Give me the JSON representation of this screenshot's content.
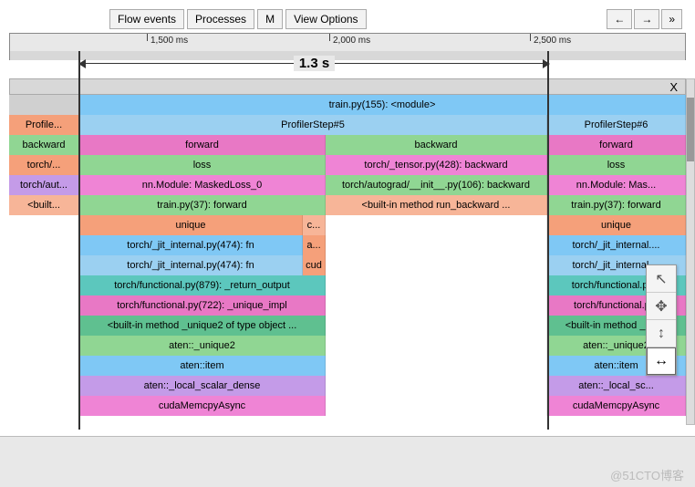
{
  "toolbar": {
    "flow_events": "Flow events",
    "processes": "Processes",
    "m": "M",
    "view_options": "View Options",
    "nav_prev": "←",
    "nav_next": "→",
    "nav_expand": "»"
  },
  "ruler": {
    "t1": "1,500 ms",
    "t2": "2,000 ms",
    "t3": "2,500 ms"
  },
  "range": {
    "label": "1.3 s"
  },
  "close_x": "X",
  "rows": {
    "r1": {
      "a": "train.py(155): <module>"
    },
    "r2": {
      "left": "Profile...",
      "mid": "ProfilerStep#5",
      "right": "ProfilerStep#6"
    },
    "r3": {
      "left": "backward",
      "mid1": "forward",
      "mid2": "backward",
      "right": "forward"
    },
    "r4": {
      "left": "torch/...",
      "mid1": "loss",
      "mid2": "torch/_tensor.py(428): backward",
      "right": "loss"
    },
    "r5": {
      "left": "torch/aut...",
      "mid1": "nn.Module: MaskedLoss_0",
      "mid2": "torch/autograd/__init__.py(106): backward",
      "right": "nn.Module: Mas..."
    },
    "r6": {
      "left": "<built...",
      "mid1": "train.py(37): forward",
      "mid2": "<built-in method run_backward ...",
      "right": "train.py(37): forward"
    },
    "r7": {
      "mid1": "unique",
      "mid2": "c...",
      "right": "unique"
    },
    "r8": {
      "mid1": "torch/_jit_internal.py(474): fn",
      "mid2": "a...",
      "right": "torch/_jit_internal...."
    },
    "r9": {
      "mid1": "torch/_jit_internal.py(474): fn",
      "mid2": "cud",
      "right": "torch/_jit_internal...."
    },
    "r10": {
      "mid1": "torch/functional.py(879): _return_output",
      "right": "torch/functional.py..."
    },
    "r11": {
      "mid1": "torch/functional.py(722): _unique_impl",
      "right": "torch/functional.p..."
    },
    "r12": {
      "mid1": "<built-in method _unique2 of type object ...",
      "right": "<built-in method _uni..."
    },
    "r13": {
      "mid1": "aten::_unique2",
      "right": "aten::_unique2"
    },
    "r14": {
      "mid1": "aten::item",
      "right": "aten::item"
    },
    "r15": {
      "mid1": "aten::_local_scalar_dense",
      "right": "aten::_local_sc..."
    },
    "r16": {
      "mid1": "cudaMemcpyAsync",
      "right": "cudaMemcpyAsync"
    }
  },
  "tool_palette": {
    "pointer": "pointer-tool",
    "pan": "pan-tool",
    "vzoom": "vertical-zoom-tool",
    "hzoom": "horizontal-zoom-tool"
  },
  "watermark": "@51CTO博客"
}
